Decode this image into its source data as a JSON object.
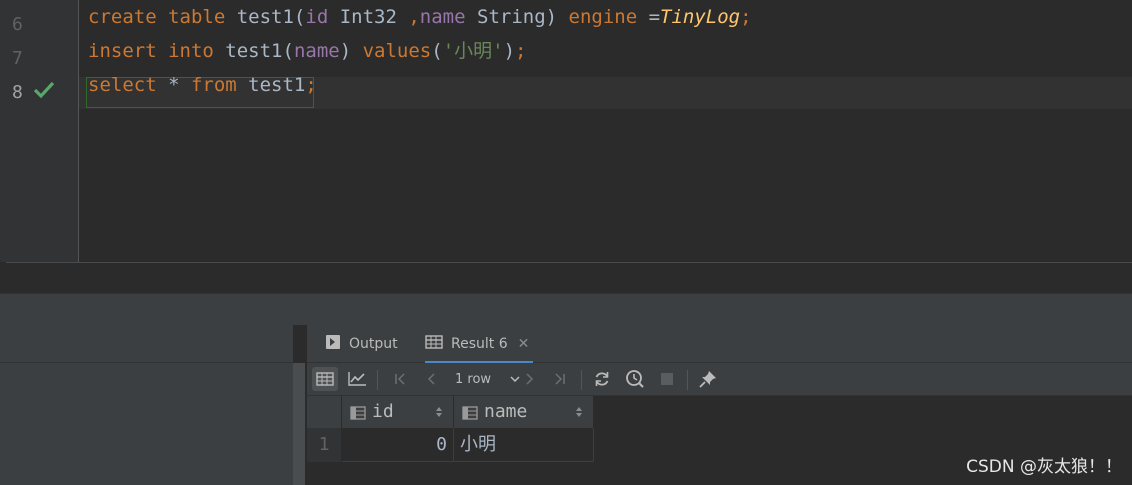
{
  "editor": {
    "lines": [
      {
        "number": "6",
        "tokens": [
          {
            "t": "create",
            "c": "kw"
          },
          {
            "t": " ",
            "c": "ident"
          },
          {
            "t": "table",
            "c": "kw"
          },
          {
            "t": " test1(",
            "c": "ident"
          },
          {
            "t": "id",
            "c": "col"
          },
          {
            "t": " Int32 ",
            "c": "ident"
          },
          {
            "t": ",",
            "c": "kw"
          },
          {
            "t": "name",
            "c": "col"
          },
          {
            "t": " String) ",
            "c": "ident"
          },
          {
            "t": "engine",
            "c": "kw"
          },
          {
            "t": " =",
            "c": "ident"
          },
          {
            "t": "TinyLog",
            "c": "fn"
          },
          {
            "t": ";",
            "c": "kw"
          }
        ]
      },
      {
        "number": "7",
        "tokens": [
          {
            "t": "insert",
            "c": "kw"
          },
          {
            "t": " ",
            "c": "ident"
          },
          {
            "t": "into",
            "c": "kw"
          },
          {
            "t": " test1(",
            "c": "ident"
          },
          {
            "t": "name",
            "c": "col"
          },
          {
            "t": ") ",
            "c": "ident"
          },
          {
            "t": "values",
            "c": "kw"
          },
          {
            "t": "(",
            "c": "ident"
          },
          {
            "t": "'小明'",
            "c": "str"
          },
          {
            "t": ")",
            "c": "ident"
          },
          {
            "t": ";",
            "c": "kw"
          }
        ]
      },
      {
        "number": "8",
        "tokens": [
          {
            "t": "select",
            "c": "kw"
          },
          {
            "t": " * ",
            "c": "ident"
          },
          {
            "t": "from",
            "c": "kw"
          },
          {
            "t": " test1",
            "c": "ident"
          },
          {
            "t": ";",
            "c": "kw"
          }
        ]
      }
    ],
    "executed_line_icon": "checkmark-icon"
  },
  "results": {
    "tabs": [
      {
        "label": "Output",
        "icon": "console-output-icon",
        "active": false
      },
      {
        "label": "Result 6",
        "icon": "table-grid-icon",
        "active": true,
        "close_icon": "close-icon"
      }
    ],
    "toolbar": {
      "row_count": "1 row"
    },
    "grid": {
      "columns": [
        "id",
        "name"
      ],
      "rows": [
        {
          "row_number": "1",
          "cells": [
            "0",
            "小明"
          ]
        }
      ]
    }
  },
  "watermark": "CSDN @灰太狼！！",
  "colors": {
    "keyword": "#cc7832",
    "column": "#9876aa",
    "string": "#6a8759",
    "function": "#ffc66d",
    "success_check": "#59a869",
    "tab_underline": "#4a88c7"
  }
}
